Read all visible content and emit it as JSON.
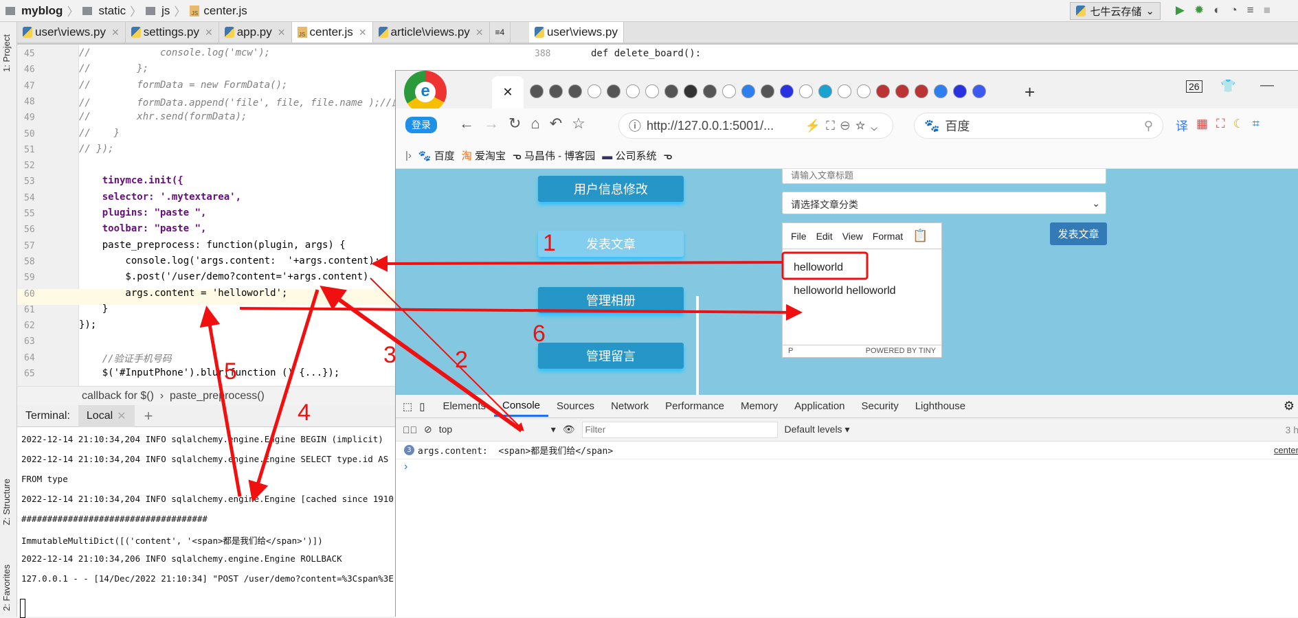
{
  "ide": {
    "breadcrumb": [
      "myblog",
      "static",
      "js",
      "center.js"
    ],
    "run_config": "七牛云存储",
    "side_tools": [
      "1: Project",
      "Z: Structure",
      "2: Favorites"
    ],
    "tabs": [
      {
        "label": "user\\views.py",
        "icon": "python-icon"
      },
      {
        "label": "settings.py",
        "icon": "python-icon"
      },
      {
        "label": "app.py",
        "icon": "python-icon"
      },
      {
        "label": "center.js",
        "icon": "js-icon",
        "active": true
      },
      {
        "label": "article\\views.py",
        "icon": "python-icon"
      }
    ],
    "tab_overflow": "≡4",
    "right_tab": "user\\views.py",
    "right_code": {
      "line": "388",
      "text": "def delete_board():"
    },
    "code": [
      {
        "n": "45",
        "t": "//            console.log('mcw');",
        "c": "cmt"
      },
      {
        "n": "46",
        "t": "//        };",
        "c": "cmt"
      },
      {
        "n": "47",
        "t": "//        formData = new FormData();",
        "c": "cmt"
      },
      {
        "n": "48",
        "t": "//        formData.append('file', file, file.name );//此处",
        "c": "cmt"
      },
      {
        "n": "49",
        "t": "//        xhr.send(formData);",
        "c": "cmt"
      },
      {
        "n": "50",
        "t": "//    }",
        "c": "cmt"
      },
      {
        "n": "51",
        "t": "// });",
        "c": "cmt"
      },
      {
        "n": "52",
        "t": "",
        "c": ""
      },
      {
        "n": "53",
        "t": "    tinymce.init({",
        "c": "prop"
      },
      {
        "n": "54",
        "t": "    selector: '.mytextarea',",
        "c": "prop"
      },
      {
        "n": "55",
        "t": "    plugins: \"paste \",",
        "c": "prop"
      },
      {
        "n": "56",
        "t": "    toolbar: \"paste \",",
        "c": "prop"
      },
      {
        "n": "57",
        "t": "    paste_preprocess: function(plugin, args) {",
        "c": ""
      },
      {
        "n": "58",
        "t": "        console.log('args.content:  '+args.content);",
        "c": ""
      },
      {
        "n": "59",
        "t": "        $.post('/user/demo?content='+args.content)",
        "c": ""
      },
      {
        "n": "60",
        "t": "        args.content = 'helloworld';",
        "c": ""
      },
      {
        "n": "61",
        "t": "    }",
        "c": ""
      },
      {
        "n": "62",
        "t": "});",
        "c": ""
      },
      {
        "n": "63",
        "t": "",
        "c": ""
      },
      {
        "n": "64",
        "t": "    //验证手机号码",
        "c": "cmt"
      },
      {
        "n": "65",
        "t": "    $('#InputPhone').blur(function () {...});",
        "c": ""
      }
    ],
    "callbar": [
      "callback for $()",
      "paste_preprocess()"
    ],
    "terminal": {
      "label": "Terminal:",
      "tab": "Local",
      "lines": [
        "2022-12-14 21:10:34,204 INFO sqlalchemy.engine.Engine BEGIN (implicit)",
        "2022-12-14 21:10:34,204 INFO sqlalchemy.engine.Engine SELECT type.id AS",
        "FROM type",
        "2022-12-14 21:10:34,204 INFO sqlalchemy.engine.Engine [cached since 1910",
        "####################################",
        "ImmutableMultiDict([('content', '<span>都是我们给</span>')])",
        "2022-12-14 21:10:34,206 INFO sqlalchemy.engine.Engine ROLLBACK",
        "127.0.0.1 - - [14/Dec/2022 21:10:34] \"POST /user/demo?content=%3Cspan%3E"
      ]
    }
  },
  "browser": {
    "login": "登录",
    "tab_count": "26",
    "url": "http://127.0.0.1:5001/...",
    "search": "百度",
    "bookmarks": [
      "百度",
      "爱淘宝",
      "马昌伟 - 博客园",
      "公司系统"
    ],
    "page": {
      "side_buttons": [
        "用户信息修改",
        "发表文章",
        "管理相册",
        "管理留言"
      ],
      "title_placeholder": "请输入文章标题",
      "category": "请选择文章分类",
      "editor_menu": [
        "File",
        "Edit",
        "View",
        "Format"
      ],
      "editor_lines": [
        "helloworld",
        "helloworld helloworld"
      ],
      "editor_status": "P",
      "powered": "POWERED BY TINY",
      "publish": "发表文章"
    },
    "devtools": {
      "tabs": [
        "Elements",
        "Console",
        "Sources",
        "Network",
        "Performance",
        "Memory",
        "Application",
        "Security",
        "Lighthouse"
      ],
      "active": "Console",
      "context": "top",
      "filter_placeholder": "Filter",
      "levels": "Default levels ▾",
      "hidden": "3 h",
      "msg_count": "3",
      "message": "args.content:  <span>都是我们给</span>",
      "source": "center",
      "prompt": "›"
    }
  },
  "annotations": [
    "1",
    "2",
    "3",
    "4",
    "5",
    "6"
  ],
  "annotation_color": "#f01010"
}
